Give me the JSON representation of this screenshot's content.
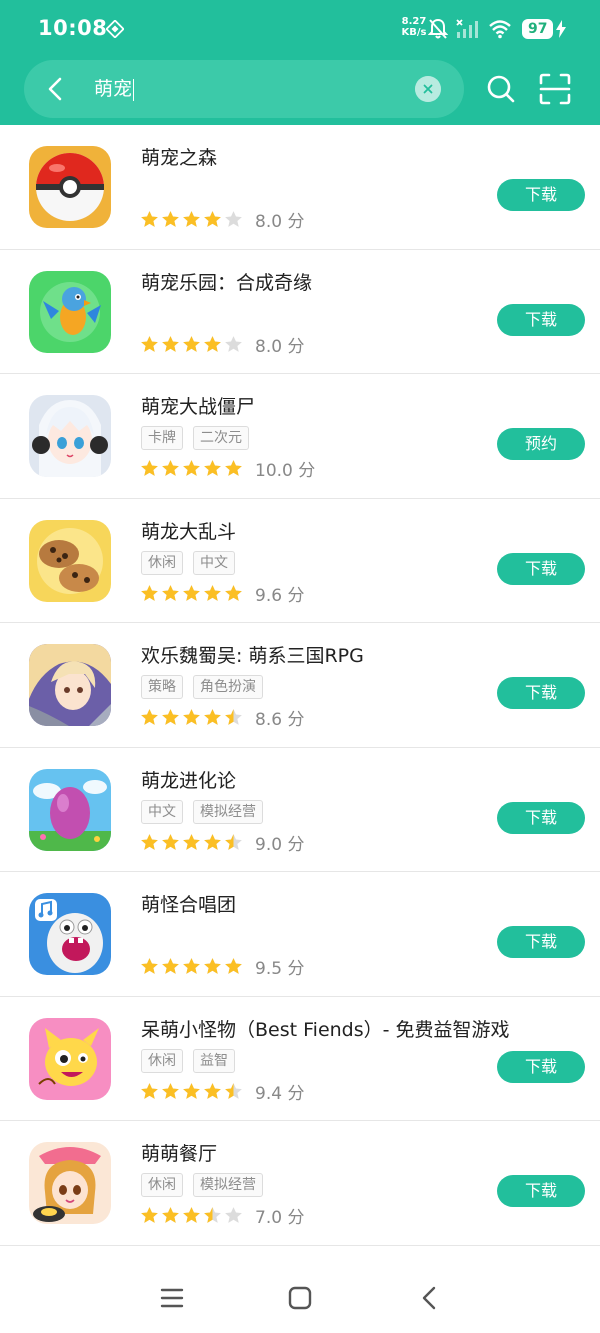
{
  "status_bar": {
    "time": "10:08",
    "net_speed_value": "8.27",
    "net_speed_unit": "KB/s",
    "battery_level": "97"
  },
  "search": {
    "query": "萌宠",
    "icons": [
      "back-arrow-icon",
      "clear-icon",
      "search-icon",
      "scan-icon"
    ]
  },
  "colors": {
    "brand": "#22bf9c",
    "star": "#fbbf24",
    "star_empty": "#dcdcdc"
  },
  "results": [
    {
      "name": "萌宠之森",
      "tags": [],
      "rating": 4,
      "score": "8.0 分",
      "action": "下载"
    },
    {
      "name": "萌宠乐园：合成奇缘",
      "tags": [],
      "rating": 4,
      "score": "8.0 分",
      "action": "下载"
    },
    {
      "name": "萌宠大战僵尸",
      "tags": [
        "卡牌",
        "二次元"
      ],
      "rating": 5,
      "score": "10.0 分",
      "action": "预约"
    },
    {
      "name": "萌龙大乱斗",
      "tags": [
        "休闲",
        "中文"
      ],
      "rating": 5,
      "score": "9.6 分",
      "action": "下载"
    },
    {
      "name": "欢乐魏蜀吴: 萌系三国RPG",
      "tags": [
        "策略",
        "角色扮演"
      ],
      "rating": 4.5,
      "score": "8.6 分",
      "action": "下载"
    },
    {
      "name": "萌龙进化论",
      "tags": [
        "中文",
        "模拟经营"
      ],
      "rating": 4.5,
      "score": "9.0 分",
      "action": "下载"
    },
    {
      "name": "萌怪合唱团",
      "tags": [],
      "rating": 5,
      "score": "9.5 分",
      "action": "下载"
    },
    {
      "name": "呆萌小怪物（Best Fiends）- 免费益智游戏",
      "tags": [
        "休闲",
        "益智"
      ],
      "rating": 4.5,
      "score": "9.4 分",
      "action": "下载"
    },
    {
      "name": "萌萌餐厅",
      "tags": [
        "休闲",
        "模拟经营"
      ],
      "rating": 3.5,
      "score": "7.0 分",
      "action": "下载"
    }
  ],
  "bottom_nav": {
    "icons": [
      "menu-icon",
      "home-icon",
      "back-icon"
    ]
  }
}
